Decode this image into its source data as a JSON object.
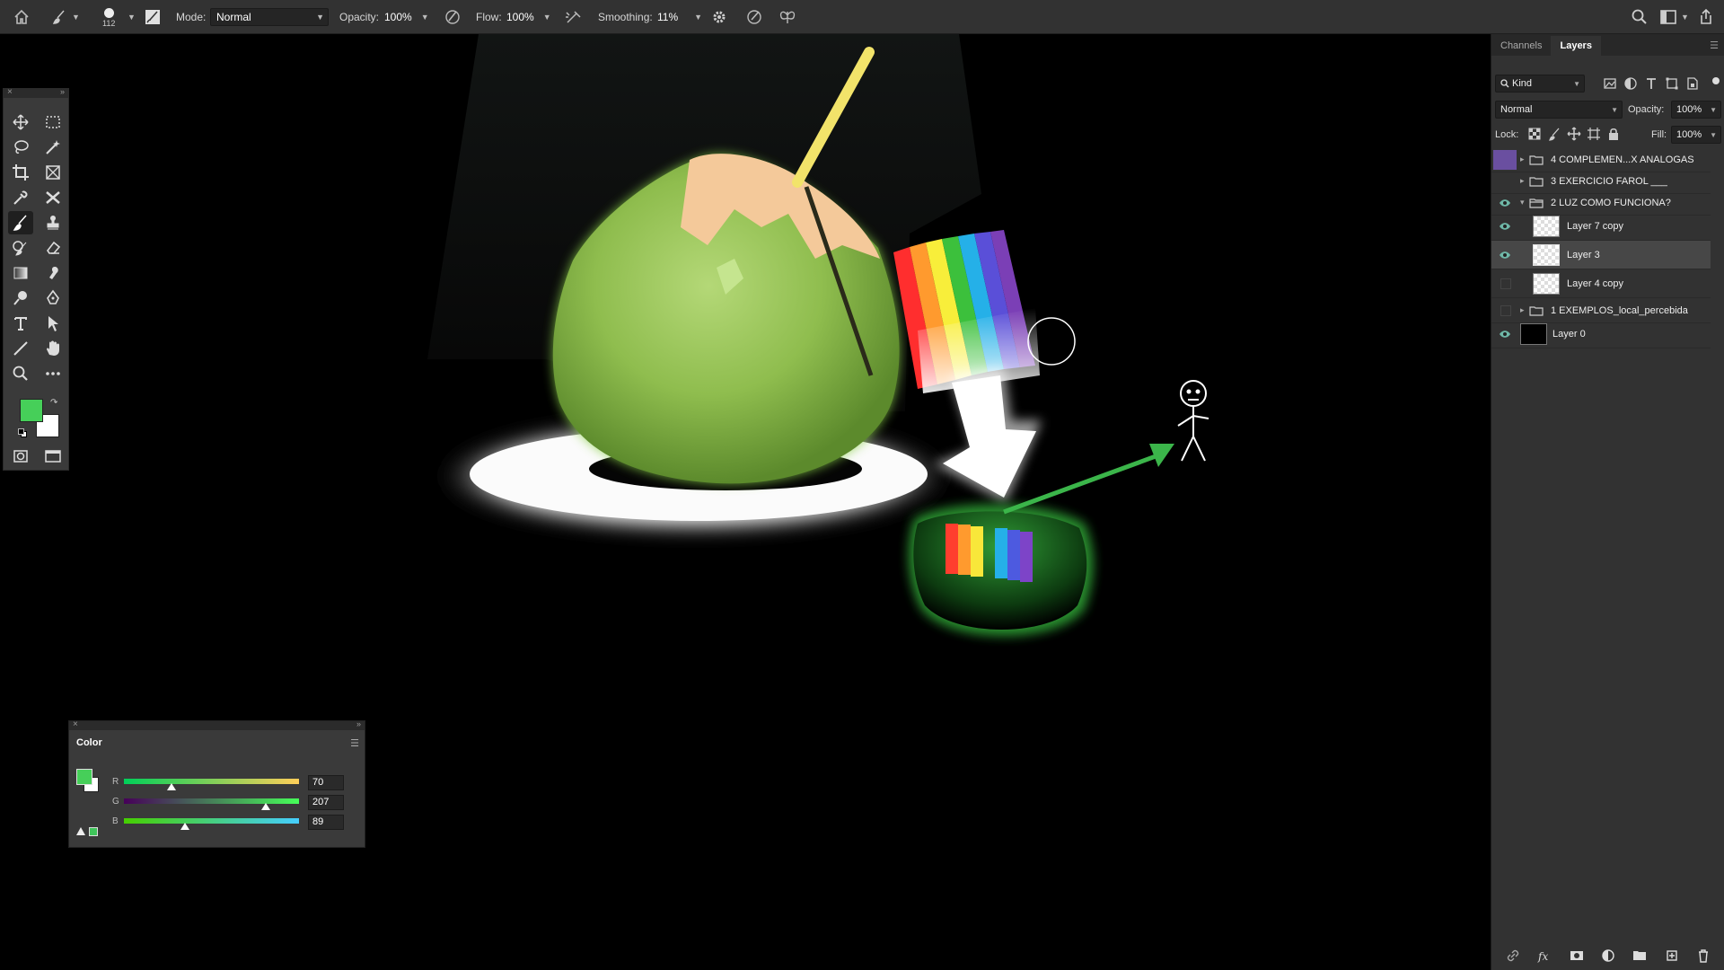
{
  "options_bar": {
    "brush_size": "112",
    "mode_label": "Mode:",
    "mode_value": "Normal",
    "opacity_label": "Opacity:",
    "opacity_value": "100%",
    "flow_label": "Flow:",
    "flow_value": "100%",
    "smoothing_label": "Smoothing:",
    "smoothing_value": "11%"
  },
  "colors": {
    "foreground": "#46CF59",
    "background": "#FFFFFF",
    "panel_bg": "#323232",
    "selected_layer_bg": "#474747"
  },
  "layers_panel": {
    "tabs": [
      "Channels",
      "Layers"
    ],
    "active_tab": "Layers",
    "filter_label": "Kind",
    "blend_mode": "Normal",
    "opacity_label": "Opacity:",
    "opacity_value": "100%",
    "lock_label": "Lock:",
    "fill_label": "Fill:",
    "fill_value": "100%",
    "layers": [
      {
        "name": "4 COMPLEMEN...X ANALOGAS",
        "type": "group",
        "visible": false,
        "swatch": "#6a4fa0"
      },
      {
        "name": "3 EXERCICIO FAROL ___",
        "type": "group",
        "visible": false
      },
      {
        "name": "2 LUZ COMO FUNCIONA?",
        "type": "group",
        "visible": true,
        "expanded": true
      },
      {
        "name": "Layer 7 copy",
        "type": "layer",
        "visible": true,
        "indent": true
      },
      {
        "name": "Layer 3",
        "type": "layer",
        "visible": true,
        "indent": true,
        "selected": true
      },
      {
        "name": "Layer 4 copy",
        "type": "layer",
        "visible": false,
        "indent": true
      },
      {
        "name": "1 EXEMPLOS_local_percebida",
        "type": "group",
        "visible": false
      },
      {
        "name": "Layer 0",
        "type": "layer",
        "visible": true,
        "thumb": "black"
      }
    ]
  },
  "color_panel": {
    "title": "Color",
    "channels": [
      {
        "label": "R",
        "value": "70",
        "fraction": 0.2745
      },
      {
        "label": "G",
        "value": "207",
        "fraction": 0.8118
      },
      {
        "label": "B",
        "value": "89",
        "fraction": 0.349
      }
    ]
  }
}
